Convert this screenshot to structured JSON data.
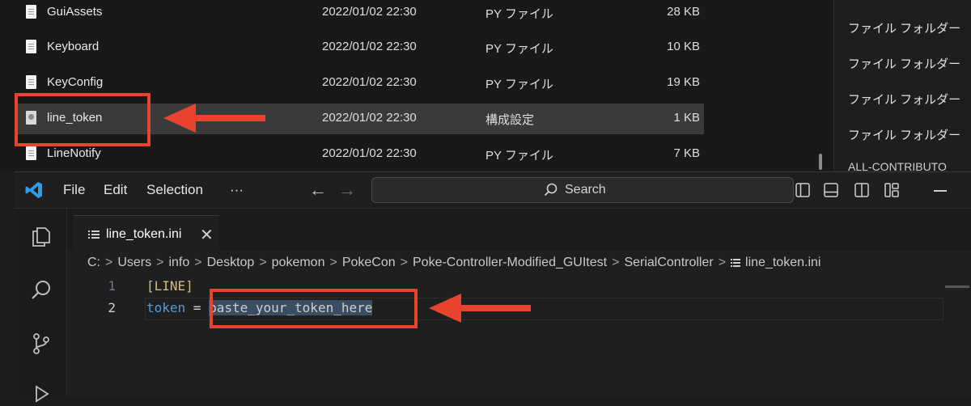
{
  "explorer": {
    "files": [
      {
        "name": "GuiAssets",
        "date": "2022/01/02 22:30",
        "type": "PY ファイル",
        "size": "28 KB",
        "icon": "py-file-icon"
      },
      {
        "name": "Keyboard",
        "date": "2022/01/02 22:30",
        "type": "PY ファイル",
        "size": "10 KB",
        "icon": "py-file-icon"
      },
      {
        "name": "KeyConfig",
        "date": "2022/01/02 22:30",
        "type": "PY ファイル",
        "size": "19 KB",
        "icon": "py-file-icon"
      },
      {
        "name": "line_token",
        "date": "2022/01/02 22:30",
        "type": "構成設定",
        "size": "1 KB",
        "icon": "config-file-icon",
        "selected": true
      },
      {
        "name": "LineNotify",
        "date": "2022/01/02 22:30",
        "type": "PY ファイル",
        "size": "7 KB",
        "icon": "py-file-icon"
      }
    ],
    "right_column": [
      "ファイル フォルダー",
      "ファイル フォルダー",
      "ファイル フォルダー",
      "ファイル フォルダー"
    ],
    "right_truncated": "ALL-CONTRIBUTO"
  },
  "vscode": {
    "menu": [
      "File",
      "Edit",
      "Selection",
      "···"
    ],
    "search_label": "Search",
    "tab": {
      "label": "line_token.ini",
      "close": "✕"
    },
    "breadcrumb": [
      "C:",
      "Users",
      "info",
      "Desktop",
      "pokemon",
      "PokeCon",
      "Poke-Controller-Modified_GUItest",
      "SerialController",
      "line_token.ini"
    ],
    "breadcrumb_sep": ">",
    "lines": [
      {
        "number": "1",
        "section": "[LINE]"
      },
      {
        "number": "2",
        "key": "token",
        "eq": " = ",
        "value": "paste_your_token_here"
      }
    ]
  },
  "annotations": {
    "color": "#e8432d"
  }
}
